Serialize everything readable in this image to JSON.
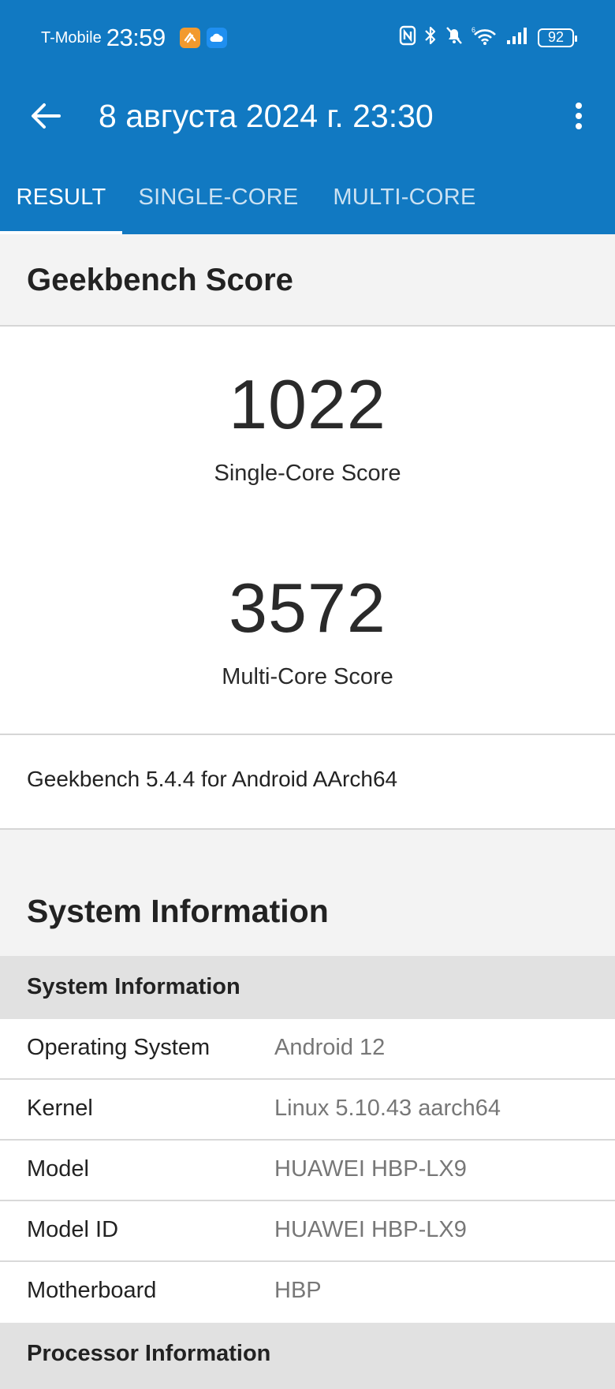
{
  "status_bar": {
    "carrier": "T-Mobile",
    "time": "23:59",
    "battery": "92"
  },
  "app_bar": {
    "title": "8 августа 2024 г. 23:30",
    "tabs": [
      {
        "label": "RESULT",
        "active": true
      },
      {
        "label": "SINGLE-CORE",
        "active": false
      },
      {
        "label": "MULTI-CORE",
        "active": false
      }
    ]
  },
  "score_section": {
    "title": "Geekbench Score",
    "single_core_value": "1022",
    "single_core_label": "Single-Core Score",
    "multi_core_value": "3572",
    "multi_core_label": "Multi-Core Score",
    "version": "Geekbench 5.4.4 for Android AArch64"
  },
  "system_section": {
    "title": "System Information",
    "group_label": "System Information",
    "rows": [
      {
        "key": "Operating System",
        "value": "Android 12"
      },
      {
        "key": "Kernel",
        "value": "Linux 5.10.43 aarch64"
      },
      {
        "key": "Model",
        "value": "HUAWEI HBP-LX9"
      },
      {
        "key": "Model ID",
        "value": "HUAWEI HBP-LX9"
      },
      {
        "key": "Motherboard",
        "value": "HBP"
      }
    ],
    "next_group_label": "Processor Information"
  },
  "colors": {
    "app_bar": "#1179c2",
    "background": "#f3f3f3",
    "sub_header": "#e1e1e1",
    "value_text": "#777777"
  }
}
